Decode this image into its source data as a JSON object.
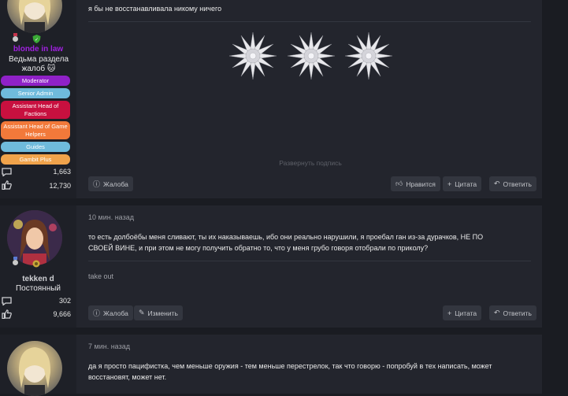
{
  "posts": [
    {
      "username": "blonde in law",
      "user_title": "Ведьма раздела жалоб 🐱",
      "badges": [
        {
          "label": "Moderator",
          "color": "#8f21c7"
        },
        {
          "label": "Senior Admin",
          "color": "#6fbbdc"
        },
        {
          "label": "Assistant Head of Factions",
          "color": "#c8103f"
        },
        {
          "label": "Assistant Head of Game Helpers",
          "color": "#f2793a"
        },
        {
          "label": "Guides",
          "color": "#6fbbdc"
        },
        {
          "label": "Gambit Plus",
          "color": "#f0a34b"
        }
      ],
      "messages_count": "1,663",
      "reactions_count": "12,730",
      "text": "я бы не восстанавливала никому ничего",
      "expand_signature": "Развернуть подпись",
      "buttons": {
        "report": "Жалоба",
        "like": "Нравится",
        "quote": "Цитата",
        "reply": "Ответить"
      }
    },
    {
      "username": "tekken d",
      "user_title": "Постоянный",
      "messages_count": "302",
      "reactions_count": "9,666",
      "date": "10 мин. назад",
      "text_line1": "то есть долбоёбы меня сливают, ты их наказываешь, ибо они реально нарушили, я проебал ган из-за дурачков, НЕ ПО",
      "text_line2": "СВОЕЙ ВИНЕ, и при этом не могу получить обратно то, что у меня грубо говоря отобрали по приколу?",
      "signature": "take out",
      "buttons": {
        "report": "Жалоба",
        "edit": "Изменить",
        "quote": "Цитата",
        "reply": "Ответить"
      }
    },
    {
      "date": "7 мин. назад",
      "text_line1": "да я просто пацифистка, чем меньше оружия - тем меньше перестрелок, так что говорю - попробуй в тех написать, может",
      "text_line2": "восстановят, может нет."
    }
  ],
  "colors": {
    "username1": "#a020e0",
    "username2": "#cfd0d4",
    "background": "#1a1c22",
    "post": "#23252d"
  }
}
